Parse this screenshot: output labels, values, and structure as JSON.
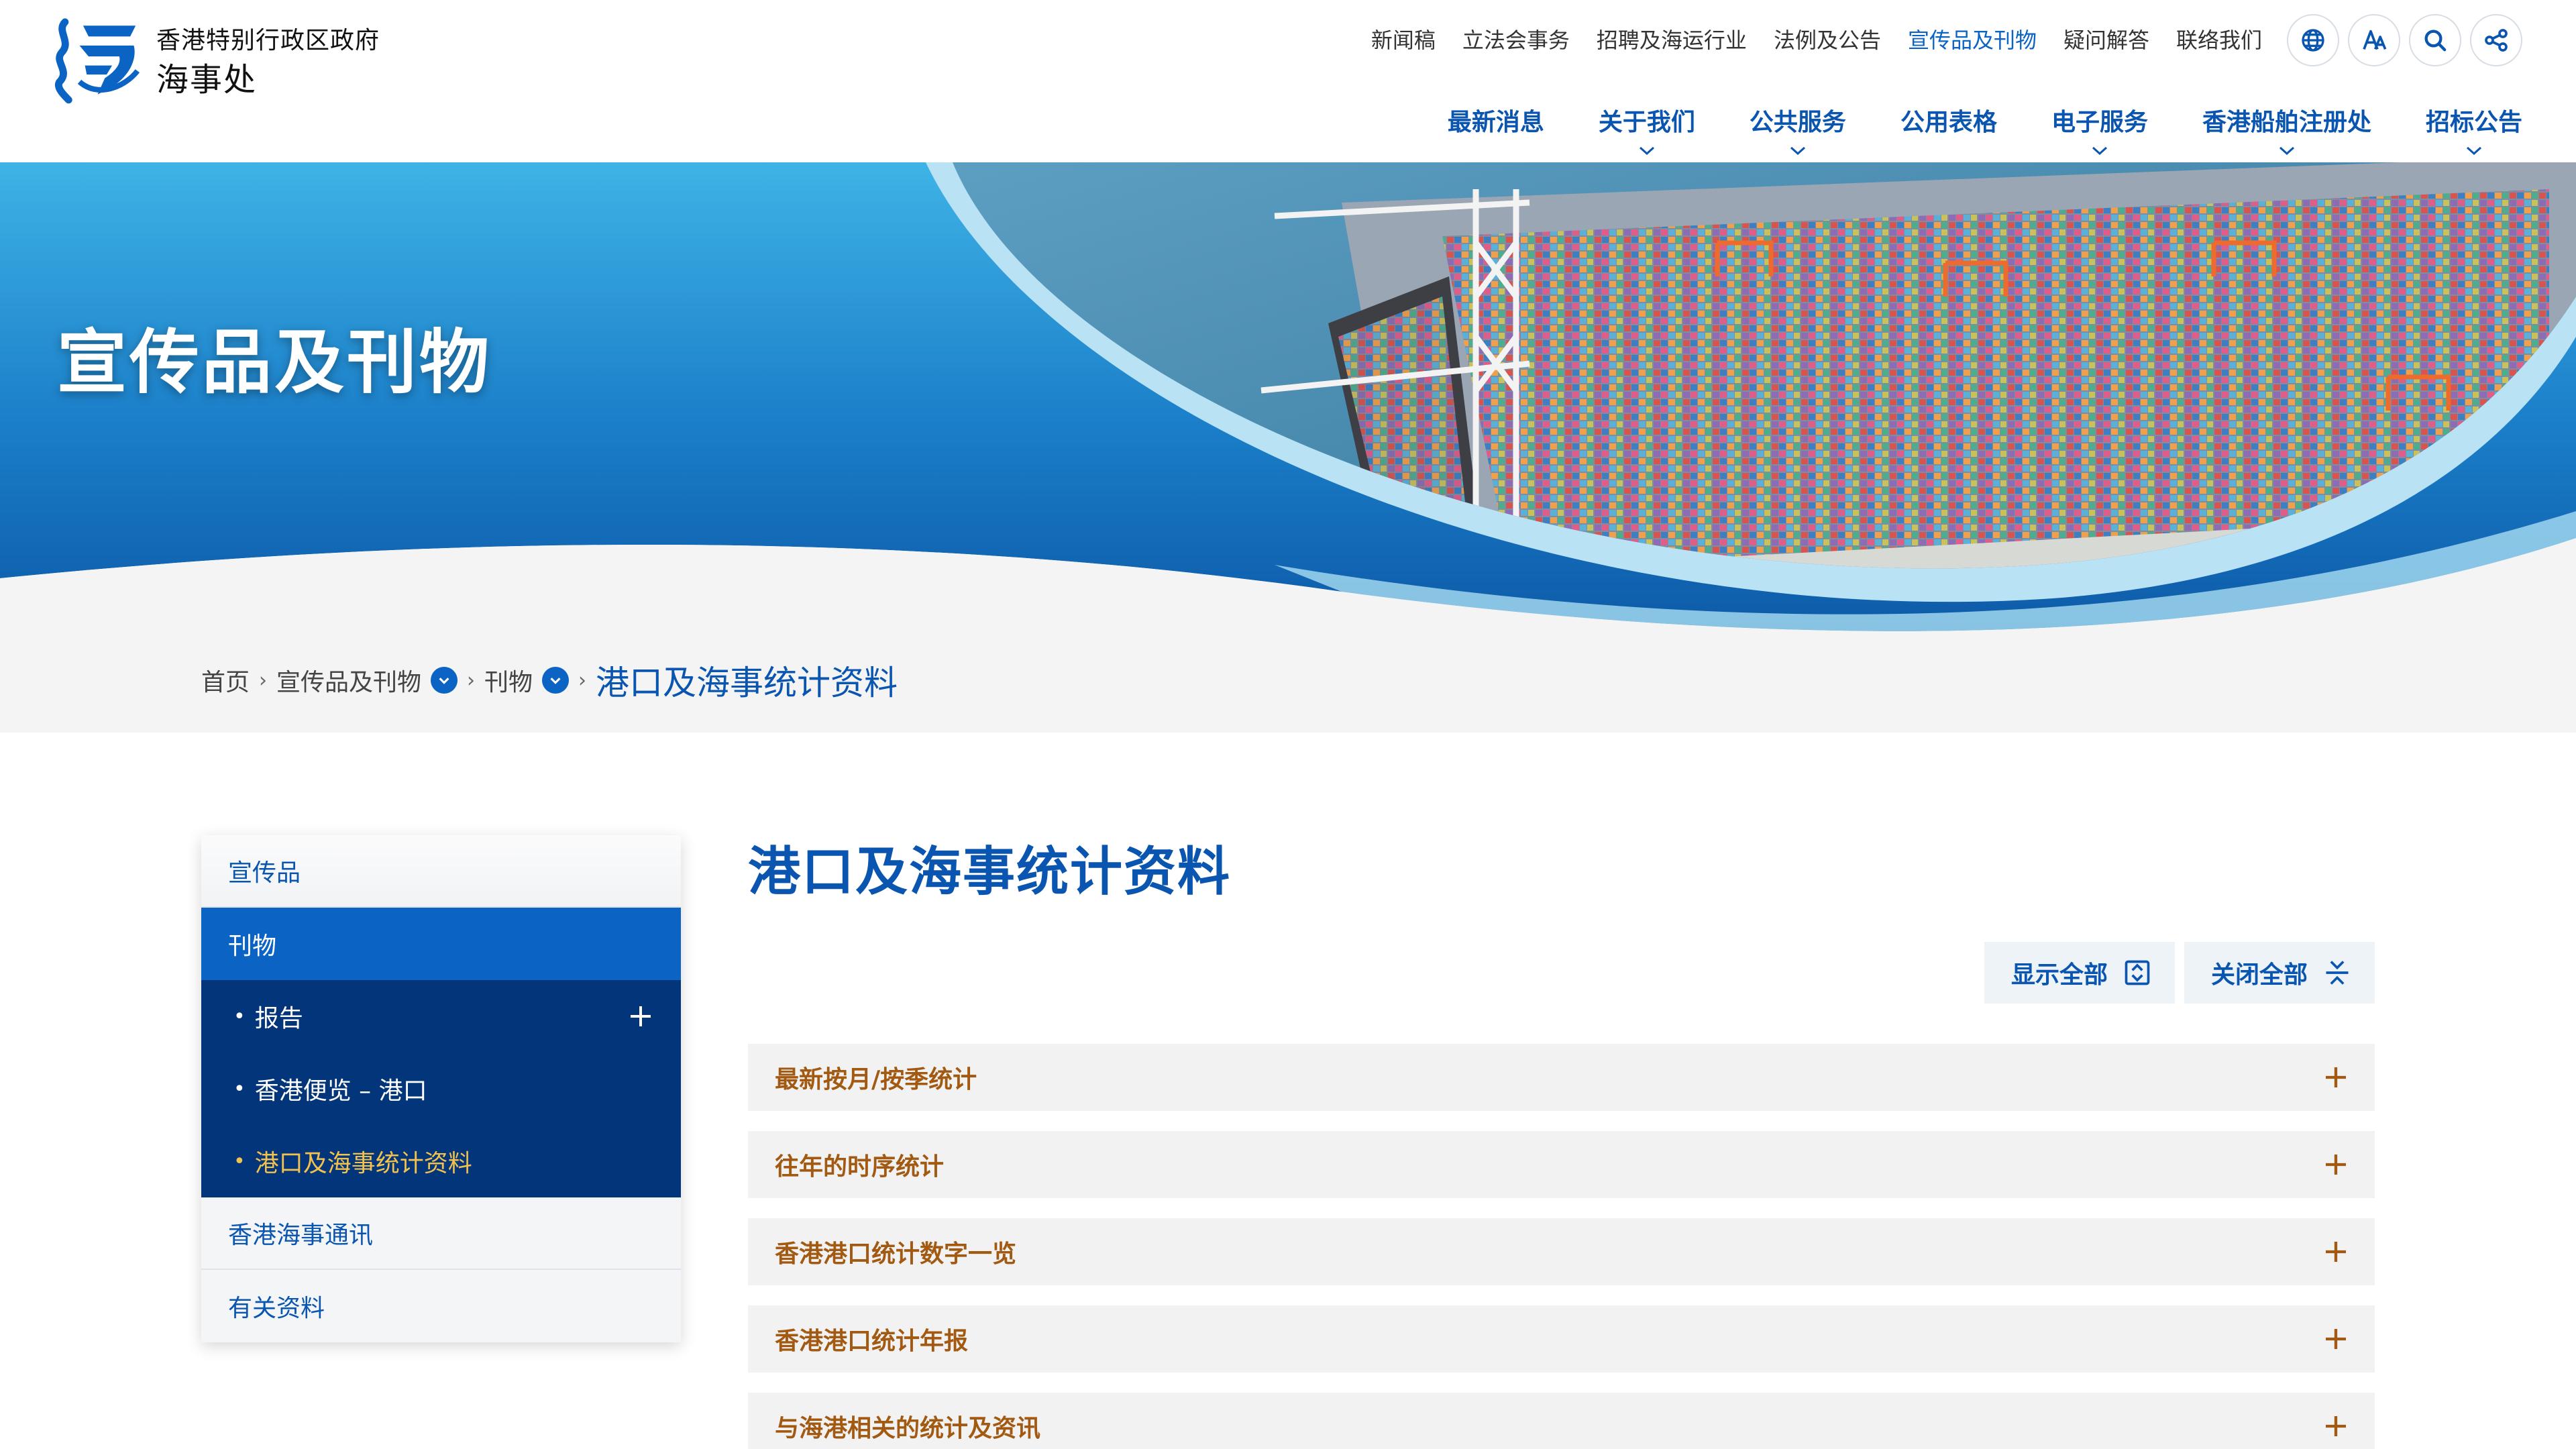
{
  "header": {
    "logo_line1": "香港特别行政区政府",
    "logo_line2": "海事处",
    "util_links": [
      {
        "label": "新闻稿",
        "active": false
      },
      {
        "label": "立法会事务",
        "active": false
      },
      {
        "label": "招聘及海运行业",
        "active": false
      },
      {
        "label": "法例及公告",
        "active": false
      },
      {
        "label": "宣传品及刊物",
        "active": true
      },
      {
        "label": "疑问解答",
        "active": false
      },
      {
        "label": "联络我们",
        "active": false
      }
    ],
    "util_icons": [
      "globe-icon",
      "font-size-icon",
      "search-icon",
      "share-icon"
    ],
    "main_nav": [
      {
        "label": "最新消息",
        "has_dropdown": false
      },
      {
        "label": "关于我们",
        "has_dropdown": true
      },
      {
        "label": "公共服务",
        "has_dropdown": true
      },
      {
        "label": "公用表格",
        "has_dropdown": false
      },
      {
        "label": "电子服务",
        "has_dropdown": true
      },
      {
        "label": "香港船舶注册处",
        "has_dropdown": true
      },
      {
        "label": "招标公告",
        "has_dropdown": true
      }
    ]
  },
  "banner": {
    "title": "宣传品及刊物"
  },
  "breadcrumb": {
    "home": "首页",
    "level1": "宣传品及刊物",
    "level2": "刊物",
    "current": "港口及海事统计资料"
  },
  "sidebar": {
    "item_publicity": "宣传品",
    "item_publications": "刊物",
    "sub_items": [
      {
        "label": "报告",
        "expandable": true,
        "current": false
      },
      {
        "label": "香港便览 – 港口",
        "expandable": false,
        "current": false
      },
      {
        "label": "港口及海事统计资料",
        "expandable": false,
        "current": true
      }
    ],
    "item_bulletin": "香港海事通讯",
    "item_related": "有关资料"
  },
  "content": {
    "heading": "港口及海事统计资料",
    "expand_all": "显示全部",
    "collapse_all": "关闭全部",
    "accordion": [
      "最新按月/按季统计",
      "往年的时序统计",
      "香港港口统计数字一览",
      "香港港口统计年报",
      "与海港相关的统计及资讯"
    ]
  },
  "colors": {
    "brand_blue": "#0a55b0",
    "accent_blue": "#0b63c4",
    "sidebar_dark": "#03357a",
    "highlight_gold": "#f2c14e",
    "accordion_text": "#a25a12"
  }
}
